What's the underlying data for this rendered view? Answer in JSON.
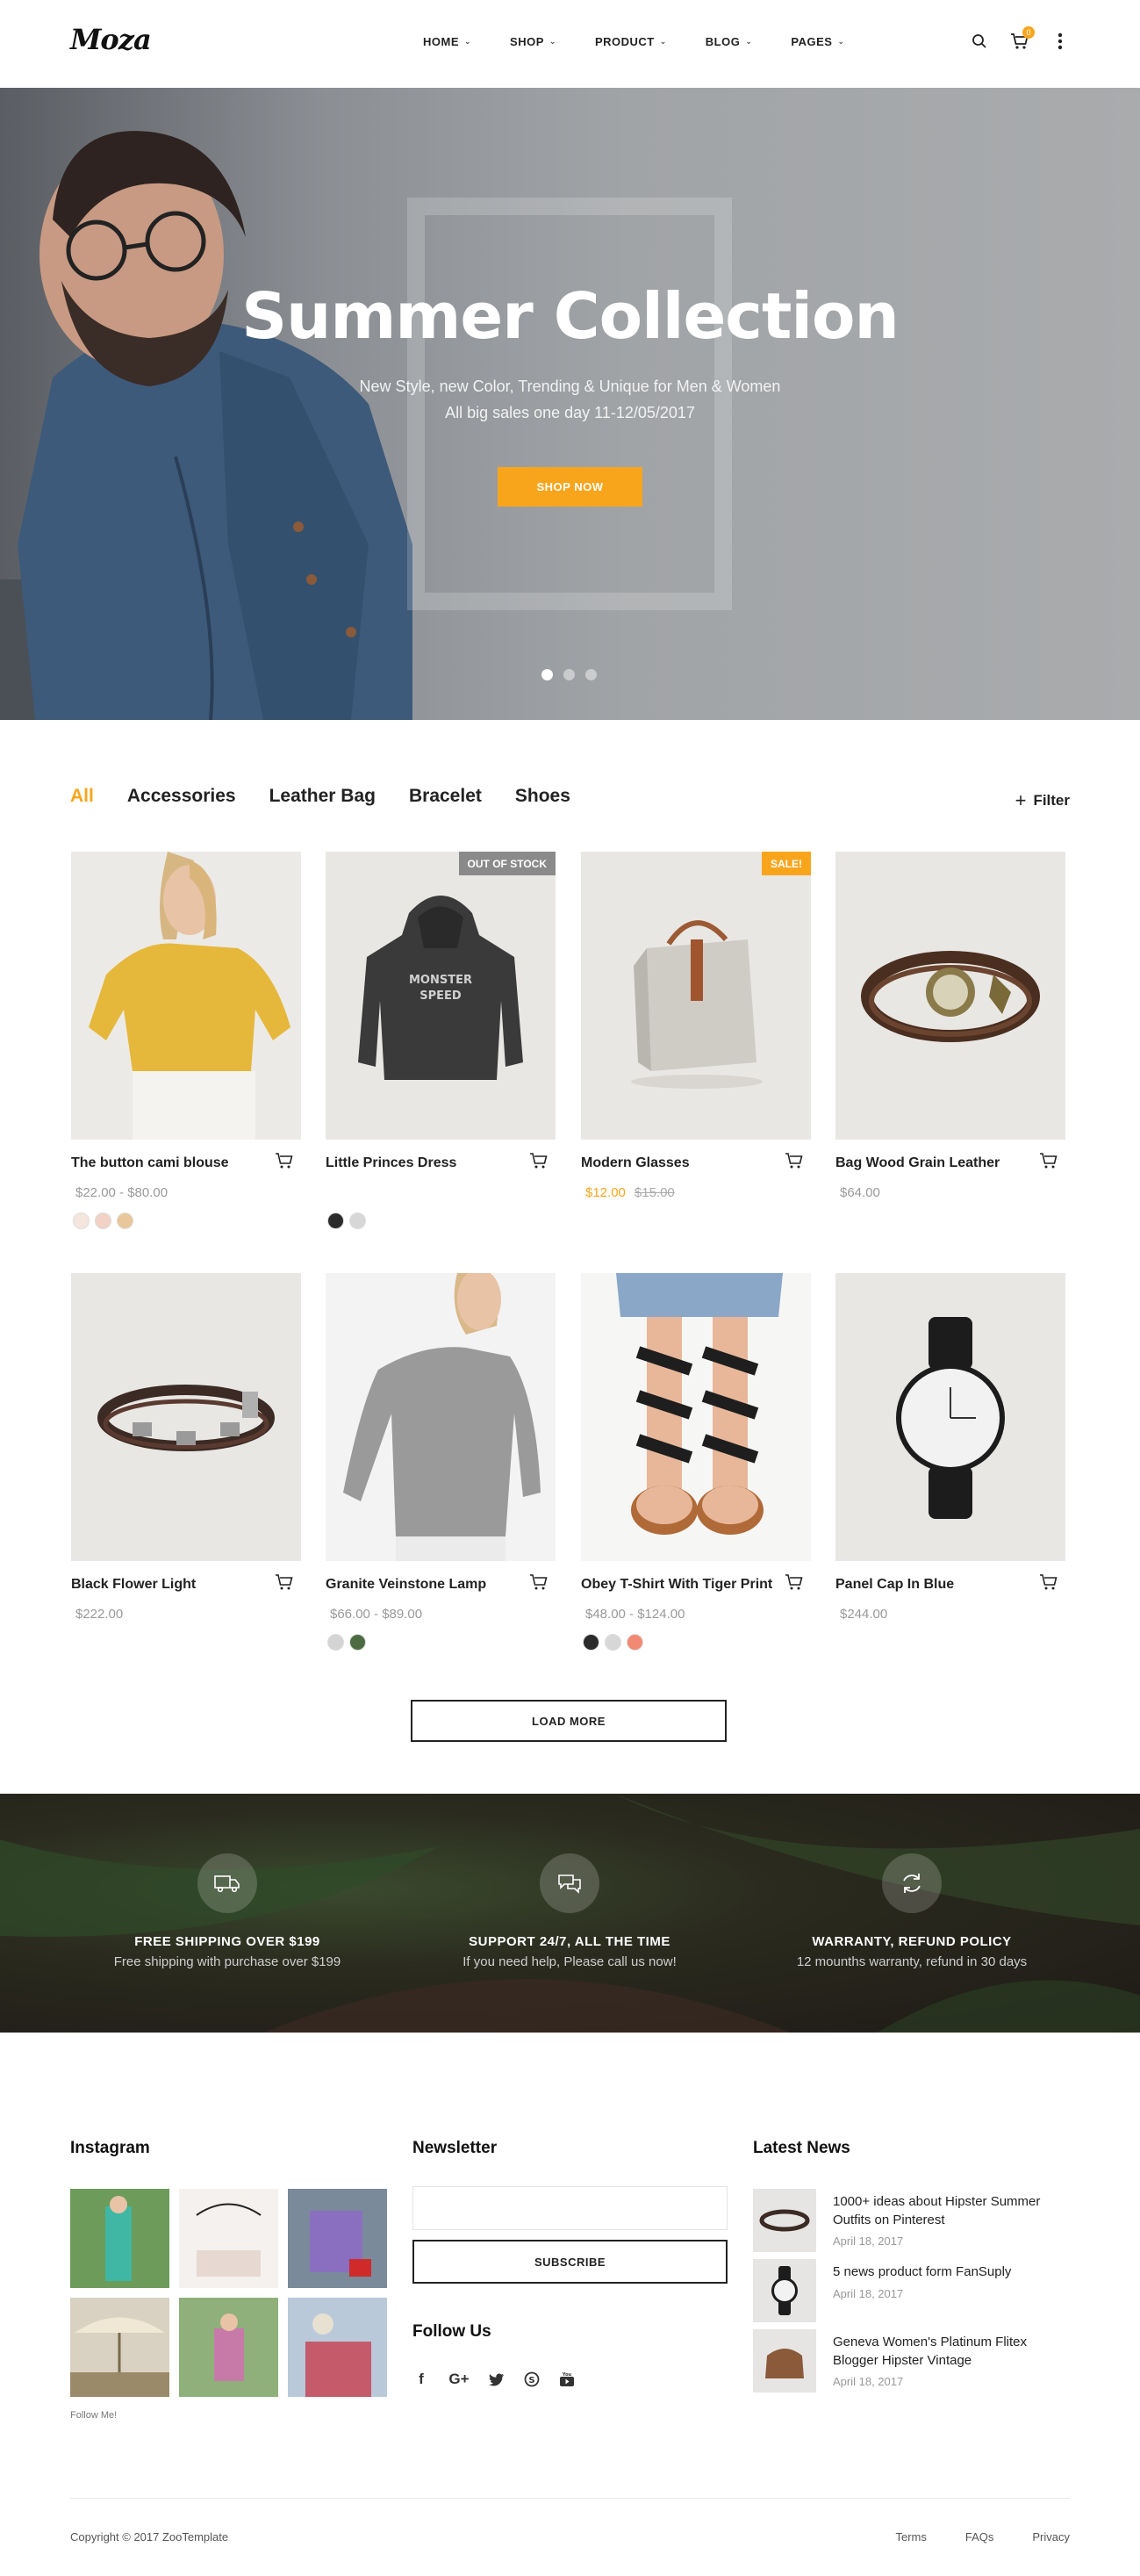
{
  "header": {
    "logo": "Moza",
    "nav": [
      "HOME",
      "SHOP",
      "PRODUCT",
      "BLOG",
      "PAGES"
    ],
    "cart_count": "0"
  },
  "hero": {
    "title": "Summer Collection",
    "subtitle_line1": "New Style, new Color, Trending & Unique for Men & Women",
    "subtitle_line2": "All big sales one day 11-12/05/2017",
    "button": "SHOP NOW",
    "slides": 3,
    "active_slide": 1
  },
  "filters": {
    "tabs": [
      "All",
      "Accessories",
      "Leather Bag",
      "Bracelet",
      "Shoes"
    ],
    "active": "All",
    "filter_label": "Filter"
  },
  "products": [
    {
      "name": "The button cami blouse",
      "price": "$22.00  -  $80.00",
      "swatches": [
        "#f4e6dc",
        "#f1d2c4",
        "#e9c79b"
      ],
      "icon": "blouse"
    },
    {
      "name": "Little Princes Dress",
      "price": "",
      "badge": "OUT OF STOCK",
      "swatches": [
        "#2b2b2b",
        "#d7d7d7"
      ],
      "icon": "hoodie"
    },
    {
      "name": "Modern Glasses",
      "sale_price": "$12.00",
      "old_price": "$15.00",
      "badge": "SALE!",
      "swatches": [],
      "icon": "bag"
    },
    {
      "name": "Bag Wood Grain Leather",
      "price": "$64.00",
      "swatches": [],
      "icon": "watch-bracelet"
    },
    {
      "name": "Black Flower Light",
      "price": "$222.00",
      "swatches": [],
      "icon": "bracelet"
    },
    {
      "name": "Granite Veinstone Lamp",
      "price": "$66.00  -  $89.00",
      "swatches": [
        "#d4d4d4",
        "#4c6b43"
      ],
      "icon": "sweater"
    },
    {
      "name": "Obey T-Shirt With Tiger Print",
      "price": "$48.00  -  $124.00",
      "swatches": [
        "#2b2b2b",
        "#d7d7d7",
        "#f28a73"
      ],
      "icon": "sandals"
    },
    {
      "name": "Panel Cap In Blue",
      "price": "$244.00",
      "swatches": [],
      "icon": "watch"
    }
  ],
  "load_more": "LOAD MORE",
  "features": [
    {
      "title": "FREE SHIPPING OVER $199",
      "text": "Free shipping with purchase over $199",
      "icon": "truck-icon"
    },
    {
      "title": "SUPPORT 24/7, ALL THE TIME",
      "text": "If you need help, Please call us now!",
      "icon": "chat-icon"
    },
    {
      "title": "WARRANTY, REFUND POLICY",
      "text": "12 mounths warranty, refund in 30 days",
      "icon": "refresh-icon"
    }
  ],
  "footer": {
    "instagram_title": "Instagram",
    "follow_me": "Follow Me!",
    "newsletter_title": "Newsletter",
    "newsletter_placeholder": "",
    "subscribe": "SUBSCRIBE",
    "follow_us": "Follow Us",
    "social": [
      "facebook-icon",
      "google-plus-icon",
      "twitter-icon",
      "skype-icon",
      "youtube-icon"
    ],
    "news_title": "Latest News",
    "news": [
      {
        "title": "1000+ ideas about Hipster Summer Outfits on Pinterest",
        "date": "April 18, 2017"
      },
      {
        "title": "5 news product form FanSuply",
        "date": "April 18, 2017"
      },
      {
        "title": "Geneva Women's Platinum Flitex Blogger Hipster Vintage",
        "date": "April 18, 2017"
      }
    ],
    "copyright": "Copyright © 2017 ZooTemplate",
    "links": [
      "Terms",
      "FAQs",
      "Privacy"
    ]
  },
  "colors": {
    "accent": "#f8a51c",
    "text": "#222222",
    "muted": "#999999"
  }
}
